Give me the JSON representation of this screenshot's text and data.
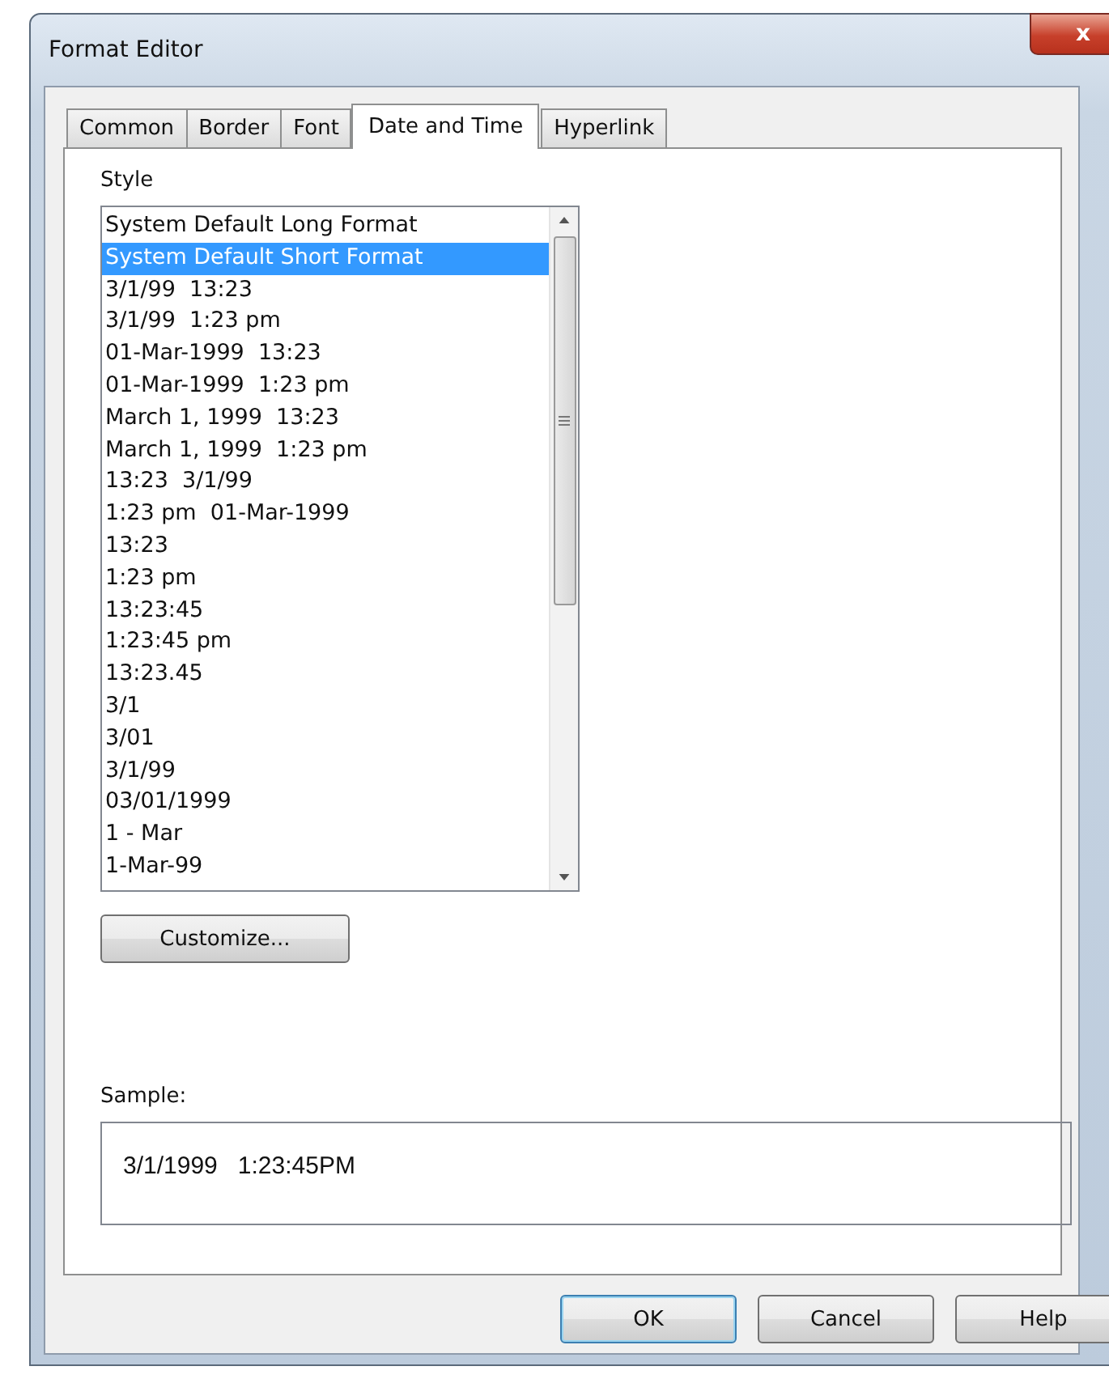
{
  "window": {
    "title": "Format Editor",
    "close": "x"
  },
  "tabs": [
    {
      "label": "Common",
      "selected": false
    },
    {
      "label": "Border",
      "selected": false
    },
    {
      "label": "Font",
      "selected": false
    },
    {
      "label": "Date and Time",
      "selected": true
    },
    {
      "label": "Hyperlink",
      "selected": false
    }
  ],
  "style": {
    "label": "Style",
    "items": [
      {
        "label": "System Default Long Format",
        "selected": false
      },
      {
        "label": "System Default Short Format",
        "selected": true
      },
      {
        "label": "3/1/99  13:23",
        "selected": false
      },
      {
        "label": "3/1/99  1:23 pm",
        "selected": false
      },
      {
        "label": "01-Mar-1999  13:23",
        "selected": false
      },
      {
        "label": "01-Mar-1999  1:23 pm",
        "selected": false
      },
      {
        "label": "March 1, 1999  13:23",
        "selected": false
      },
      {
        "label": "March 1, 1999  1:23 pm",
        "selected": false
      },
      {
        "label": "13:23  3/1/99",
        "selected": false
      },
      {
        "label": "1:23 pm  01-Mar-1999",
        "selected": false
      },
      {
        "label": "13:23",
        "selected": false
      },
      {
        "label": "1:23 pm",
        "selected": false
      },
      {
        "label": "13:23:45",
        "selected": false
      },
      {
        "label": "1:23:45 pm",
        "selected": false
      },
      {
        "label": "13:23.45",
        "selected": false
      },
      {
        "label": "3/1",
        "selected": false
      },
      {
        "label": "3/01",
        "selected": false
      },
      {
        "label": "3/1/99",
        "selected": false
      },
      {
        "label": "03/01/1999",
        "selected": false
      },
      {
        "label": "1 - Mar",
        "selected": false
      },
      {
        "label": "1-Mar-99",
        "selected": false
      }
    ]
  },
  "customize_button": "Customize...",
  "sample": {
    "label": "Sample:",
    "value": "3/1/1999   1:23:45PM"
  },
  "buttons": [
    {
      "label": "OK",
      "default": true
    },
    {
      "label": "Cancel",
      "default": false
    },
    {
      "label": "Help",
      "default": false
    }
  ]
}
